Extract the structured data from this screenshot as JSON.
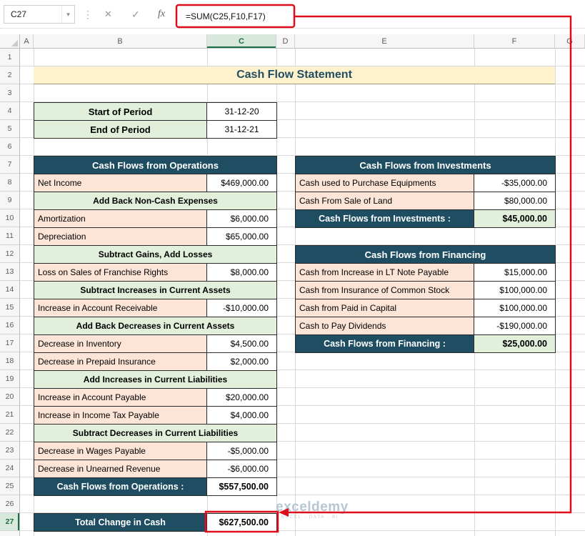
{
  "formula_bar": {
    "name_box": "C27",
    "formula": "=SUM(C25,F10,F17)",
    "icons": {
      "more": "⋮",
      "cancel": "✕",
      "enter": "✓",
      "fx": "fx",
      "dropdown": "▾"
    }
  },
  "columns": [
    "A",
    "B",
    "C",
    "D",
    "E",
    "F",
    "G"
  ],
  "row_count": 27,
  "selection": {
    "column": "C",
    "row": 27,
    "cell": "C27"
  },
  "title": {
    "text": "Cash Flow Statement"
  },
  "period_table": {
    "rows": [
      {
        "label": "Start of Period",
        "value": "31-12-20"
      },
      {
        "label": "End of Period",
        "value": "31-12-21"
      }
    ]
  },
  "operations_table": {
    "header": "Cash Flows from Operations",
    "rows": [
      {
        "type": "item",
        "label": "Net Income",
        "value": "$469,000.00"
      },
      {
        "type": "section",
        "label": "Add Back Non-Cash Expenses"
      },
      {
        "type": "item",
        "label": "Amortization",
        "value": "$6,000.00"
      },
      {
        "type": "item",
        "label": "Depreciation",
        "value": "$65,000.00"
      },
      {
        "type": "section",
        "label": "Subtract Gains, Add Losses"
      },
      {
        "type": "item",
        "label": "Loss on Sales of Franchise Rights",
        "value": "$8,000.00"
      },
      {
        "type": "section",
        "label": "Subtract Increases in Current Assets"
      },
      {
        "type": "item",
        "label": "Increase in Account Receivable",
        "value": "-$10,000.00"
      },
      {
        "type": "section",
        "label": "Add Back Decreases in Current Assets"
      },
      {
        "type": "item",
        "label": "Decrease in Inventory",
        "value": "$4,500.00"
      },
      {
        "type": "item",
        "label": "Decrease in Prepaid Insurance",
        "value": "$2,000.00"
      },
      {
        "type": "section",
        "label": "Add Increases in Current Liabilities"
      },
      {
        "type": "item",
        "label": "Increase in Account Payable",
        "value": "$20,000.00"
      },
      {
        "type": "item",
        "label": "Increase in Income Tax Payable",
        "value": "$4,000.00"
      },
      {
        "type": "section",
        "label": "Subtract Decreases in Current Liabilities"
      },
      {
        "type": "item",
        "label": "Decrease in Wages Payable",
        "value": "-$5,000.00"
      },
      {
        "type": "item",
        "label": "Decrease in Unearned Revenue",
        "value": "-$6,000.00"
      },
      {
        "type": "total",
        "label": "Cash Flows from Operations :",
        "value": "$557,500.00"
      }
    ]
  },
  "investments_table": {
    "header": "Cash Flows from Investments",
    "rows": [
      {
        "type": "item",
        "label": "Cash used to Purchase Equipments",
        "value": "-$35,000.00"
      },
      {
        "type": "item",
        "label": "Cash From Sale of Land",
        "value": "$80,000.00"
      },
      {
        "type": "total",
        "label": "Cash Flows from Investments :",
        "value": "$45,000.00"
      }
    ]
  },
  "financing_table": {
    "header": "Cash Flows from Financing",
    "rows": [
      {
        "type": "item",
        "label": "Cash from Increase in LT Note Payable",
        "value": "$15,000.00"
      },
      {
        "type": "item",
        "label": "Cash from Insurance of Common Stock",
        "value": "$100,000.00"
      },
      {
        "type": "item",
        "label": "Cash from Paid in Capital",
        "value": "$100,000.00"
      },
      {
        "type": "item",
        "label": "Cash to Pay Dividends",
        "value": "-$190,000.00"
      },
      {
        "type": "total",
        "label": "Cash Flows from Financing :",
        "value": "$25,000.00"
      }
    ]
  },
  "grand_total": {
    "label": "Total Change in Cash",
    "value": "$627,500.00"
  },
  "watermark": {
    "text": "exceldemy",
    "tagline": "EXCEL - DATA - BI"
  },
  "colors": {
    "header_dark": "#1F4E63",
    "section_green": "#E2EFDA",
    "item_peach": "#FCE4D6",
    "title_yellow": "#FFF2CC",
    "annotation_red": "#DD0F1D",
    "selection_green": "#1E7145"
  }
}
